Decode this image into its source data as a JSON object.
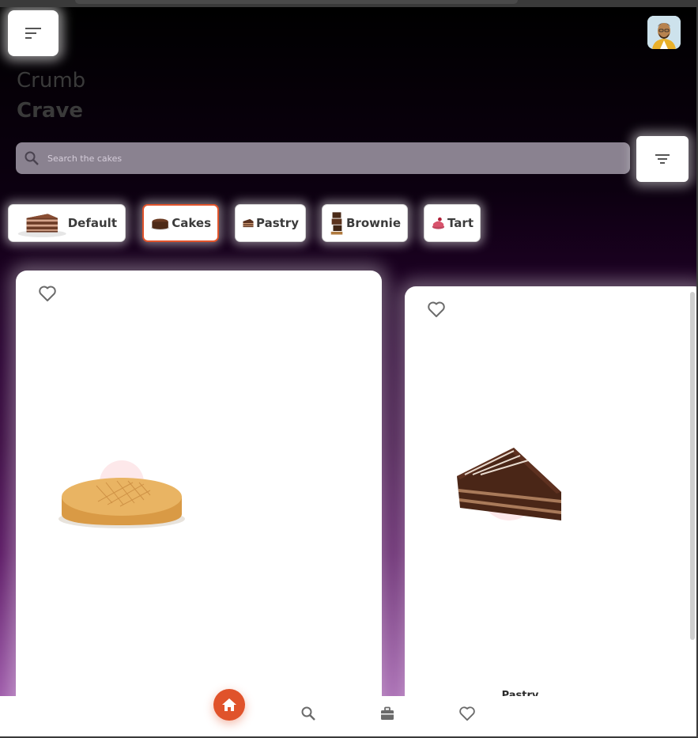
{
  "header": {
    "title_line1": "Crumb",
    "title_line2": "Crave"
  },
  "search": {
    "placeholder": "Search the cakes",
    "value": ""
  },
  "categories": [
    {
      "label": "Default",
      "active": false
    },
    {
      "label": "Cakes",
      "active": true
    },
    {
      "label": "Pastry",
      "active": false
    },
    {
      "label": "Brownie",
      "active": false
    },
    {
      "label": "Tart",
      "active": false
    }
  ],
  "products": [
    {
      "label": "",
      "image": "sponge-cake"
    },
    {
      "label": "Pastry",
      "image": "chocolate-pastry-slice"
    }
  ],
  "bottom_nav": [
    "home-icon",
    "search-icon",
    "briefcase-icon",
    "heart-icon"
  ],
  "colors": {
    "accent": "#e0532b",
    "background_top": "#000000",
    "background_bottom": "#b06bbd",
    "search_bg": "#8a8290"
  }
}
